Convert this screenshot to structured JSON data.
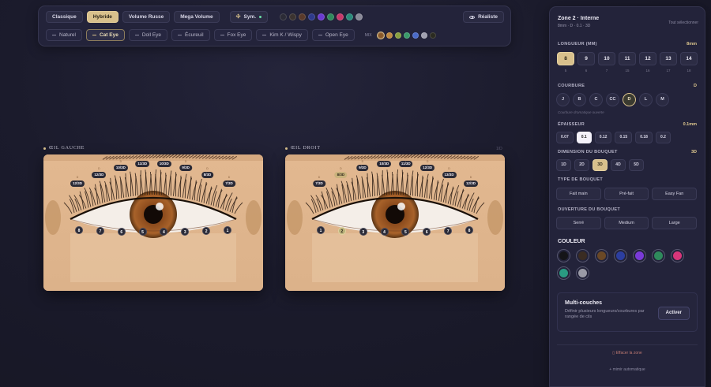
{
  "toolbar": {
    "styles": [
      {
        "label": "Classique",
        "active": false
      },
      {
        "label": "Hybride",
        "active": true
      },
      {
        "label": "Volume Russe",
        "active": false
      },
      {
        "label": "Mega Volume",
        "active": false
      }
    ],
    "sym_label": "Sym.",
    "style_swatches": [
      "#2b2b36",
      "#3b3330",
      "#5a3a2a",
      "#2e3a8c",
      "#6a3ad0",
      "#2f8a5c",
      "#c8386a",
      "#2a8a7a",
      "#8a8a98"
    ],
    "realiste_label": "Réaliste",
    "shapes": [
      {
        "label": "Naturel",
        "active": false
      },
      {
        "label": "Cat Eye",
        "active": true
      },
      {
        "label": "Doll Eye",
        "active": false
      },
      {
        "label": "Écureuil",
        "active": false
      },
      {
        "label": "Fox Eye",
        "active": false
      },
      {
        "label": "Kim K / Wispy",
        "active": false
      },
      {
        "label": "Open Eye",
        "active": false
      }
    ],
    "mix_label": "MIX",
    "shape_swatches": [
      "#8a5a2a",
      "#c08a40",
      "#8aa040",
      "#3a9a6a",
      "#4a6ac8",
      "#a0a0b0",
      "#2a2a20"
    ]
  },
  "left_eye": {
    "title": "ŒIL GAUCHE",
    "tags": [
      "12/3D",
      "12/3D",
      "10/3D",
      "11/3D",
      "10/3D",
      "9/3D",
      "8/3D",
      "7/3D"
    ],
    "tag_labels": [
      "D",
      "D",
      "D",
      "D",
      "D",
      "D",
      "D",
      "D"
    ],
    "zones": [
      "8",
      "7",
      "6",
      "5",
      "4",
      "3",
      "2",
      "1"
    ]
  },
  "right_eye": {
    "title": "ŒIL DROIT",
    "hint": "1/D",
    "tags": [
      "7/3D",
      "8/3D",
      "9/3D",
      "10/3D",
      "11/3D",
      "12/3D",
      "13/3D",
      "12/3D"
    ],
    "tag_labels": [
      "D",
      "D",
      "D",
      "D",
      "D",
      "D",
      "D",
      "D"
    ],
    "zones": [
      "1",
      "2",
      "3",
      "4",
      "5",
      "6",
      "7",
      "8"
    ],
    "selected_zone": "2"
  },
  "sidebar": {
    "zone_title": "Zone 2 · Interne",
    "zone_sub": "8mm · D · 0.1 · 3D",
    "select_all": "Tout sélectionner",
    "length": {
      "label": "LONGUEUR (MM)",
      "value": "8mm",
      "options": [
        "8",
        "9",
        "10",
        "11",
        "12",
        "13",
        "14"
      ],
      "subs": [
        "5",
        "6",
        "7",
        "15",
        "16",
        "17",
        "18"
      ],
      "selected": "8"
    },
    "curl": {
      "label": "COURBURE",
      "value": "D",
      "options": [
        "J",
        "B",
        "C",
        "CC",
        "D",
        "L",
        "M"
      ],
      "selected": "D",
      "note": "Courbure dramatique ouverte"
    },
    "thickness": {
      "label": "ÉPAISSEUR",
      "value": "0.1mm",
      "options": [
        "0.07",
        "0.1",
        "0.12",
        "0.15",
        "0.18",
        "0.2"
      ],
      "selected": "0.1"
    },
    "bouquet_dim": {
      "label": "DIMENSION DU BOUQUET",
      "value": "3D",
      "options": [
        "1D",
        "2D",
        "3D",
        "4D",
        "5D"
      ],
      "selected": "3D"
    },
    "bouquet_type": {
      "label": "TYPE DE BOUQUET",
      "options": [
        "Fait main",
        "Pré-fait",
        "Easy Fan"
      ]
    },
    "bouquet_open": {
      "label": "OUVERTURE DU BOUQUET",
      "options": [
        "Serré",
        "Medium",
        "Large"
      ]
    },
    "color": {
      "label": "COULEUR",
      "swatches": [
        "#151518",
        "#3a2c22",
        "#6a4826",
        "#2c3ea0",
        "#7a3ad8",
        "#2f8a5c",
        "#d8367a",
        "#2a9a82",
        "#9a9aa6"
      ]
    },
    "multi": {
      "title": "Multi-couches",
      "desc": "Définir plusieurs longueurs/courbures par rangée de cils",
      "button": "Activer"
    },
    "erase": "Effacer la zone",
    "auto": "+ mimir automatique"
  }
}
